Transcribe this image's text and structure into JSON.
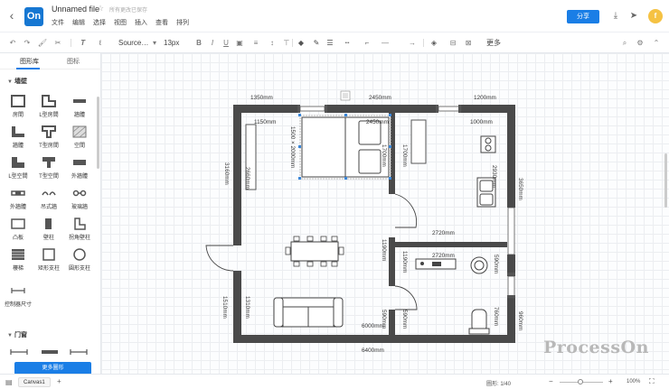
{
  "app": {
    "file_name": "Unnamed file",
    "save_status": "所有更改已保存",
    "logo_text": "On",
    "share_label": "分享",
    "avatar_initial": "f",
    "menus": [
      "文件",
      "编辑",
      "选择",
      "视图",
      "插入",
      "查看",
      "排列"
    ]
  },
  "toolbar": {
    "font_name": "Source…",
    "font_size": "13px",
    "more_label": "更多"
  },
  "left_panel": {
    "tabs": [
      "图形库",
      "图标"
    ],
    "section_walls": "墙壁",
    "section_doors": "门窗",
    "shapes": [
      "房間",
      "L型房間",
      "牆體",
      "牆體",
      "T型房間",
      "空間",
      "L型空間",
      "T型空間",
      "外牆體",
      "外牆體",
      "吊式牆",
      "玻璃牆",
      "凸板",
      "壁柱",
      "拐角壁柱",
      "樓梯",
      "矩形支柱",
      "圓形支柱",
      "控制器尺寸"
    ],
    "more_shapes_button": "更多圖形"
  },
  "floorplan": {
    "dimensions": {
      "top_left": "1350mm",
      "top_middle": "2450mm",
      "top_right": "1200mm",
      "room1_width": "1150mm",
      "bed_width": "2450mm",
      "bath_top_width": "1000mm",
      "bed_size": "1500 × 2000mm",
      "wardrobe_height": "1700mm",
      "left_wall_upper": "3160mm",
      "bedroom_left_height": "2660mm",
      "kitchen_height": "2930mm",
      "right_wall": "3650mm",
      "corridor_width": "2720mm",
      "kitchen_counter": "2720mm",
      "partition_height": "1190mm",
      "bath_height": "590mm",
      "left_wall_lower": "1510mm",
      "living_height": "1310mm",
      "living_width": "6000mm",
      "door_left": "590mm",
      "door_right": "590mm",
      "toilet_height": "760mm",
      "right_lower": "960mm",
      "total_width": "6400mm"
    }
  },
  "watermark": "ProcessOn",
  "statusbar": {
    "canvas_tab": "Canvas1",
    "shape_count": "圖形: 1/40",
    "zoom": "100%"
  }
}
